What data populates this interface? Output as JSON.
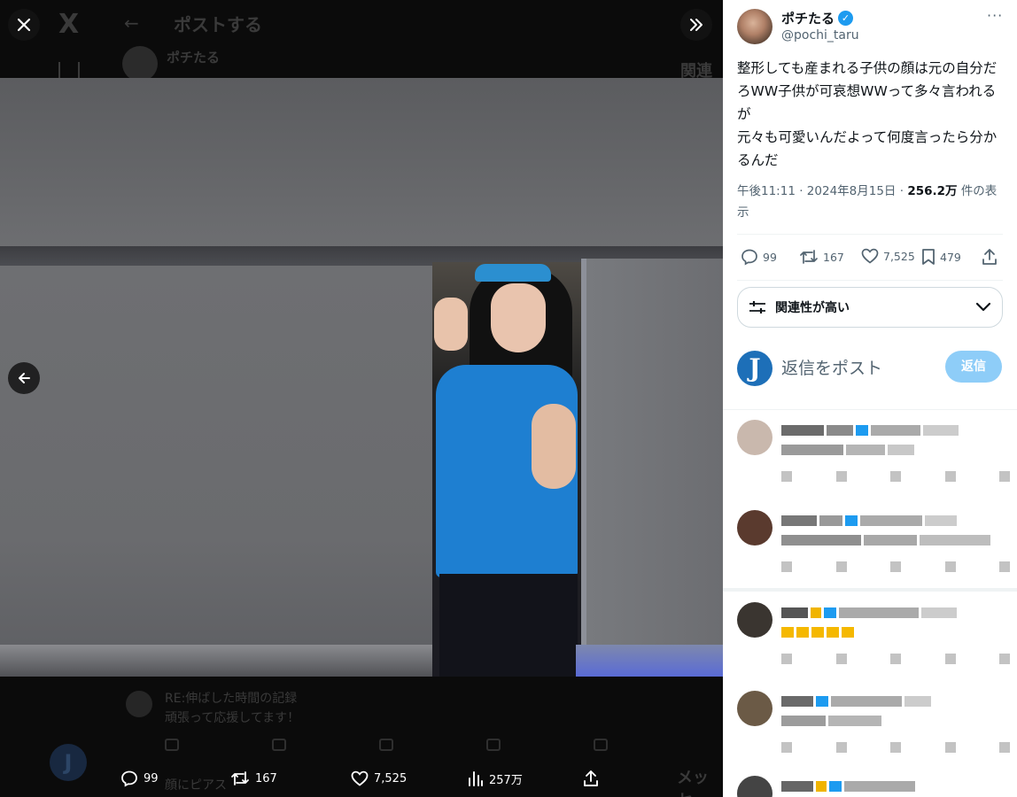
{
  "background": {
    "logo": "X",
    "header_title": "ポストする",
    "author_name": "ポチたる",
    "related_label": "関連",
    "reply_preview_user": "RE:伸ばした時間の記録",
    "reply_preview_text": "頑張って応援してます！",
    "reply2_text": "顔にピアス",
    "messages_label": "メッセ"
  },
  "media_bar": {
    "replies": "99",
    "reposts": "167",
    "likes": "7,525",
    "views": "257万"
  },
  "post": {
    "author_name": "ポチたる",
    "handle": "@pochi_taru",
    "text": "整形しても産まれる子供の顔は元の自分だろWW子供が可哀想WWって多々言われるが\n元々も可愛いんだよって何度言ったら分かるんだ",
    "time": "午後11:11",
    "date": "2024年8月15日",
    "views_count": "256.2万",
    "views_label": "件の表示",
    "stats": {
      "replies": "99",
      "reposts": "167",
      "likes": "7,525",
      "bookmarks": "479"
    }
  },
  "sort": {
    "label": "関連性が高い"
  },
  "reply_box": {
    "placeholder": "返信をポスト",
    "button": "返信"
  },
  "colors": {
    "accent": "#1d9bf0",
    "reply_button_disabled": "#8ecdf8",
    "muted_text": "#536471"
  }
}
